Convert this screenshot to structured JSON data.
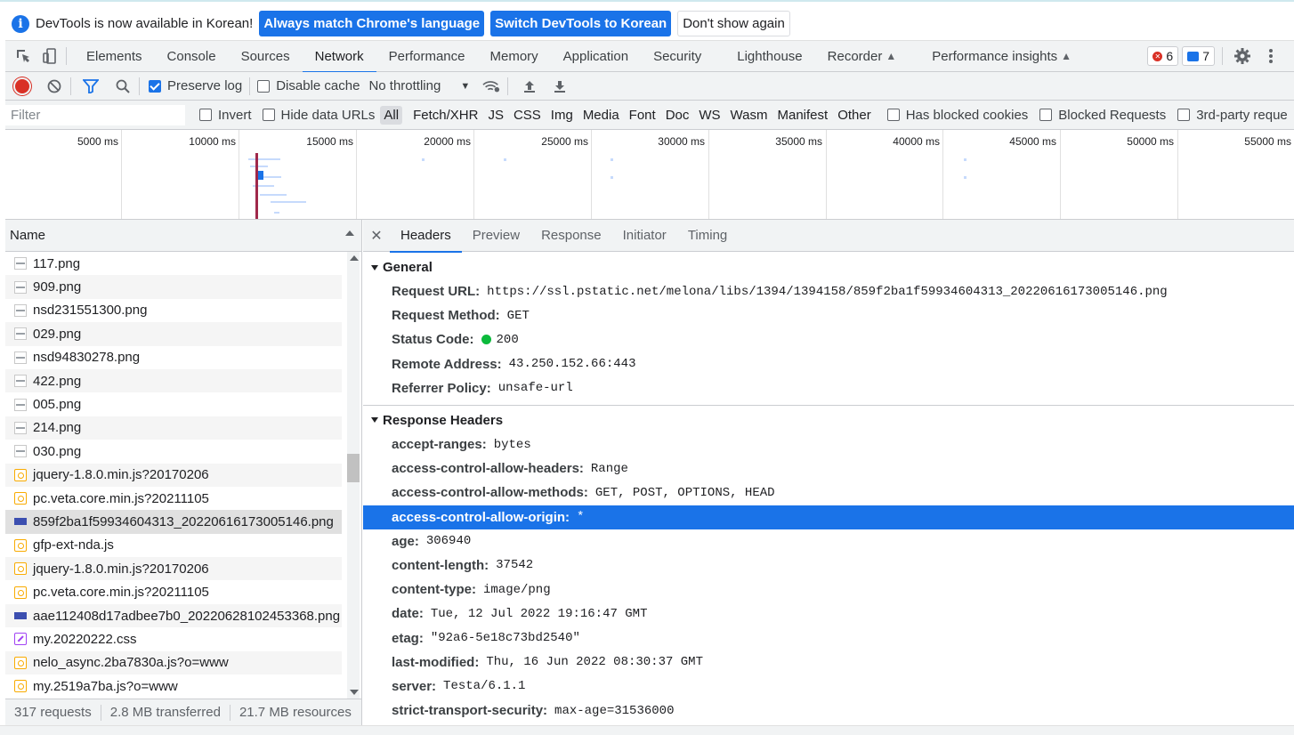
{
  "infobar": {
    "message": "DevTools is now available in Korean!",
    "btn_match": "Always match Chrome's language",
    "btn_switch": "Switch DevTools to Korean",
    "btn_dismiss": "Don't show again"
  },
  "tabs": [
    "Elements",
    "Console",
    "Sources",
    "Network",
    "Performance",
    "Memory",
    "Application",
    "Security",
    "Lighthouse",
    "Recorder",
    "Performance insights"
  ],
  "active_tab": "Network",
  "badges": {
    "errors": "6",
    "messages": "7"
  },
  "toolbar": {
    "preserve_log": "Preserve log",
    "disable_cache": "Disable cache",
    "throttling": "No throttling"
  },
  "filter": {
    "placeholder": "Filter",
    "invert": "Invert",
    "hide_data_urls": "Hide data URLs",
    "types": [
      "All",
      "Fetch/XHR",
      "JS",
      "CSS",
      "Img",
      "Media",
      "Font",
      "Doc",
      "WS",
      "Wasm",
      "Manifest",
      "Other"
    ],
    "active_type": "All",
    "has_blocked_cookies": "Has blocked cookies",
    "blocked_requests": "Blocked Requests",
    "third_party": "3rd-party reque"
  },
  "overview": {
    "ticks": [
      "5000 ms",
      "10000 ms",
      "15000 ms",
      "20000 ms",
      "25000 ms",
      "30000 ms",
      "35000 ms",
      "40000 ms",
      "45000 ms",
      "50000 ms",
      "55000 ms"
    ]
  },
  "requests": {
    "header": "Name",
    "items": [
      {
        "name": "117.png",
        "type": "png"
      },
      {
        "name": "909.png",
        "type": "png"
      },
      {
        "name": "nsd231551300.png",
        "type": "png"
      },
      {
        "name": "029.png",
        "type": "png"
      },
      {
        "name": "nsd94830278.png",
        "type": "png"
      },
      {
        "name": "422.png",
        "type": "png"
      },
      {
        "name": "005.png",
        "type": "png"
      },
      {
        "name": "214.png",
        "type": "png"
      },
      {
        "name": "030.png",
        "type": "png"
      },
      {
        "name": "jquery-1.8.0.min.js?20170206",
        "type": "js"
      },
      {
        "name": "pc.veta.core.min.js?20211105",
        "type": "js"
      },
      {
        "name": "859f2ba1f59934604313_20220616173005146.png",
        "type": "img"
      },
      {
        "name": "gfp-ext-nda.js",
        "type": "js"
      },
      {
        "name": "jquery-1.8.0.min.js?20170206",
        "type": "js"
      },
      {
        "name": "pc.veta.core.min.js?20211105",
        "type": "js"
      },
      {
        "name": "aae112408d17adbee7b0_20220628102453368.png",
        "type": "img"
      },
      {
        "name": "my.20220222.css",
        "type": "css"
      },
      {
        "name": "nelo_async.2ba7830a.js?o=www",
        "type": "js"
      },
      {
        "name": "my.2519a7ba.js?o=www",
        "type": "js"
      }
    ]
  },
  "status": {
    "requests": "317 requests",
    "transferred": "2.8 MB transferred",
    "resources": "21.7 MB resources"
  },
  "details": {
    "tabs": [
      "Headers",
      "Preview",
      "Response",
      "Initiator",
      "Timing"
    ],
    "active_tab": "Headers",
    "general_title": "General",
    "general": [
      {
        "k": "Request URL:",
        "v": "https://ssl.pstatic.net/melona/libs/1394/1394158/859f2ba1f59934604313_20220616173005146.png"
      },
      {
        "k": "Request Method:",
        "v": "GET"
      },
      {
        "k": "Status Code:",
        "v": "200"
      },
      {
        "k": "Remote Address:",
        "v": "43.250.152.66:443"
      },
      {
        "k": "Referrer Policy:",
        "v": "unsafe-url"
      }
    ],
    "response_title": "Response Headers",
    "response": [
      {
        "k": "accept-ranges:",
        "v": "bytes"
      },
      {
        "k": "access-control-allow-headers:",
        "v": "Range"
      },
      {
        "k": "access-control-allow-methods:",
        "v": "GET, POST, OPTIONS, HEAD"
      },
      {
        "k": "access-control-allow-origin:",
        "v": "*"
      },
      {
        "k": "age:",
        "v": "306940"
      },
      {
        "k": "content-length:",
        "v": "37542"
      },
      {
        "k": "content-type:",
        "v": "image/png"
      },
      {
        "k": "date:",
        "v": "Tue, 12 Jul 2022 19:16:47 GMT"
      },
      {
        "k": "etag:",
        "v": "\"92a6-5e18c73bd2540\""
      },
      {
        "k": "last-modified:",
        "v": "Thu, 16 Jun 2022 08:30:37 GMT"
      },
      {
        "k": "server:",
        "v": "Testa/6.1.1"
      },
      {
        "k": "strict-transport-security:",
        "v": "max-age=31536000"
      }
    ]
  },
  "colors": {
    "accent": "#1a73e8",
    "record": "#d93025",
    "status_ok": "#0cba3c"
  }
}
